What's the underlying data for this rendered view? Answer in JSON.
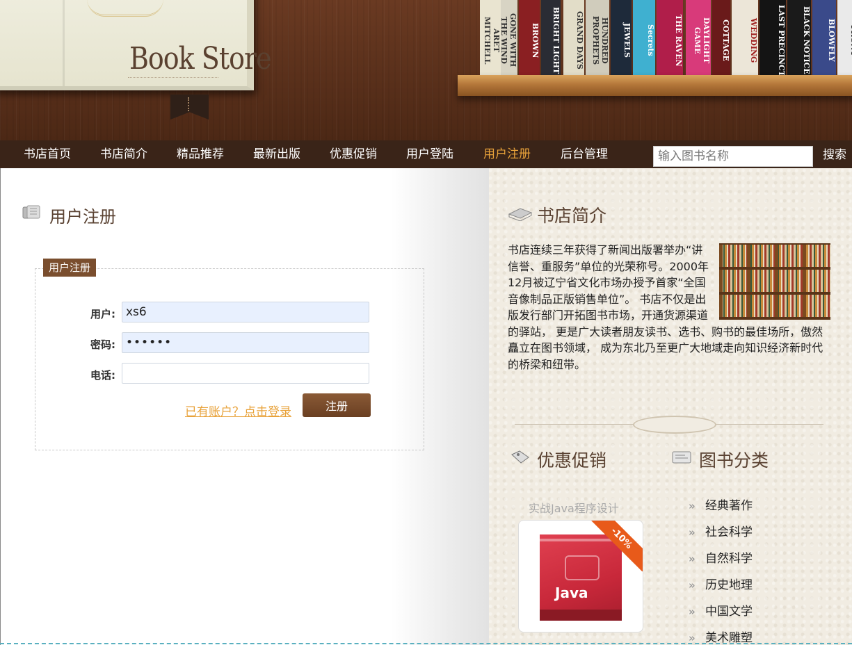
{
  "header": {
    "logo_text": "Book Store",
    "shelf_spines": [
      "ARET MITCHELL",
      "GONE WITH THE WIND",
      "BROWN",
      "BRIGHT LIGHT",
      "GRAND DAYS",
      "HUNDRED PROPHETS",
      "JEWELS",
      "Secrets",
      "THE RAVEN",
      "DAYLIGHT GAME",
      "COTTAGE",
      "WEDDING",
      "LAST PRECINCT",
      "BLACK NOTICE",
      "BLOWFLY",
      "FRONT"
    ]
  },
  "nav": {
    "items": [
      {
        "label": "书店首页"
      },
      {
        "label": "书店简介"
      },
      {
        "label": "精品推荐"
      },
      {
        "label": "最新出版"
      },
      {
        "label": "优惠促销"
      },
      {
        "label": "用户登陆"
      },
      {
        "label": "用户注册",
        "active": true
      },
      {
        "label": "后台管理"
      }
    ],
    "search_placeholder": "输入图书名称",
    "search_label": "搜索",
    "active_color": "#e8a23a"
  },
  "register": {
    "page_title": "用户注册",
    "legend": "用户注册",
    "username_label": "用户:",
    "username_value": "xs6",
    "password_label": "密码:",
    "password_value": "••••••",
    "phone_label": "电话:",
    "phone_value": "",
    "login_link": "已有账户？点击登录",
    "submit_label": "注册"
  },
  "sidebar": {
    "intro_title": "书店简介",
    "intro_text": "书店连续三年获得了新闻出版署举办“讲信誉、重服务”单位的光荣称号。2000年12月被辽宁省文化市场办授予首家“全国音像制品正版销售单位”。 书店不仅是出版发行部门开拓图书市场，开通货源渠道的驿站， 更是广大读者朋友读书、选书、购书的最佳场所，傲然矗立在图书领域， 成为东北乃至更广大地域走向知识经济新时代的桥梁和纽带。",
    "promo_title": "优惠促销",
    "promo_book_title": "实战Java程序设计",
    "promo_cover_text": "Java",
    "promo_discount": "-10%",
    "category_title": "图书分类",
    "categories": [
      "经典著作",
      "社会科学",
      "自然科学",
      "历史地理",
      "中国文学",
      "美术雕塑"
    ]
  }
}
